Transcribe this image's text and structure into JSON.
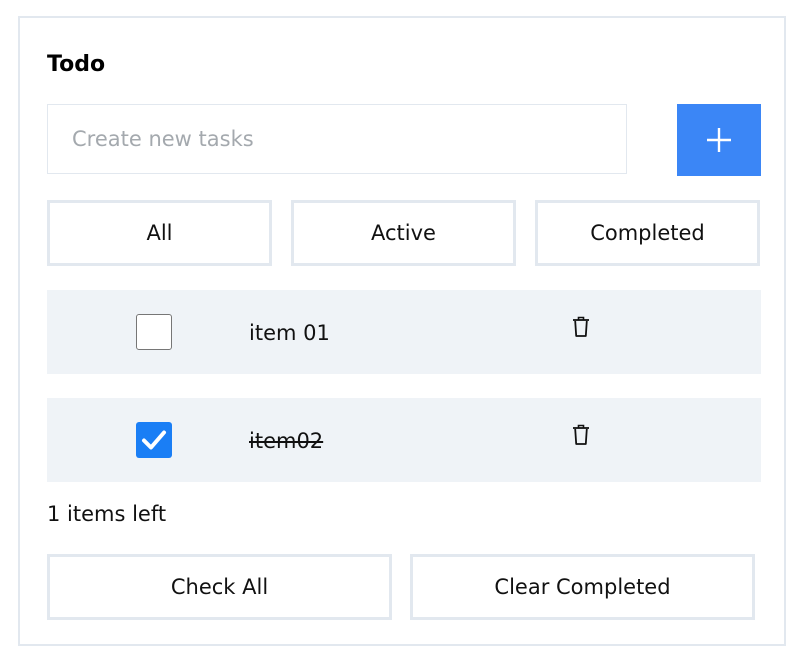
{
  "title": "Todo",
  "new_task": {
    "placeholder": "Create new tasks",
    "value": ""
  },
  "add_button": {
    "icon": "plus-icon",
    "color": "#3b86f6"
  },
  "filters": [
    {
      "label": "All"
    },
    {
      "label": "Active"
    },
    {
      "label": "Completed"
    }
  ],
  "todos": [
    {
      "label": "item 01",
      "completed": false,
      "delete_icon": "trash-icon"
    },
    {
      "label": "item02",
      "completed": true,
      "delete_icon": "trash-icon"
    }
  ],
  "items_left": "1 items left",
  "actions": {
    "check_all": "Check All",
    "clear_completed": "Clear Completed"
  },
  "colors": {
    "accent": "#3b86f6",
    "checkbox_checked": "#1a7ef5",
    "row_background": "#eff3f7",
    "border": "#e2e8ef"
  }
}
